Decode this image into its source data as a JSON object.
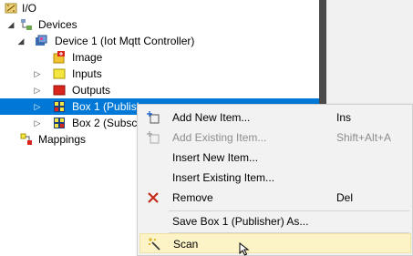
{
  "tree": {
    "io": "I/O",
    "devices": "Devices",
    "device1": "Device 1 (Iot Mqtt Controller)",
    "image": "Image",
    "inputs": "Inputs",
    "outputs": "Outputs",
    "box1": "Box 1 (Publish...",
    "box2": "Box 2 (Subscr",
    "mappings": "Mappings"
  },
  "menu": {
    "add_new_item": "Add New Item...",
    "add_new_item_shortcut": "Ins",
    "add_existing_item": "Add Existing Item...",
    "add_existing_item_shortcut": "Shift+Alt+A",
    "insert_new_item": "Insert New Item...",
    "insert_existing_item": "Insert Existing Item...",
    "remove": "Remove",
    "remove_shortcut": "Del",
    "save_as": "Save Box 1 (Publisher) As...",
    "scan": "Scan"
  },
  "colors": {
    "selection": "#0078d7",
    "menu_bg": "#f2f2f2",
    "hover_bg": "#fcf3c7",
    "remove_icon": "#c42b1c"
  }
}
